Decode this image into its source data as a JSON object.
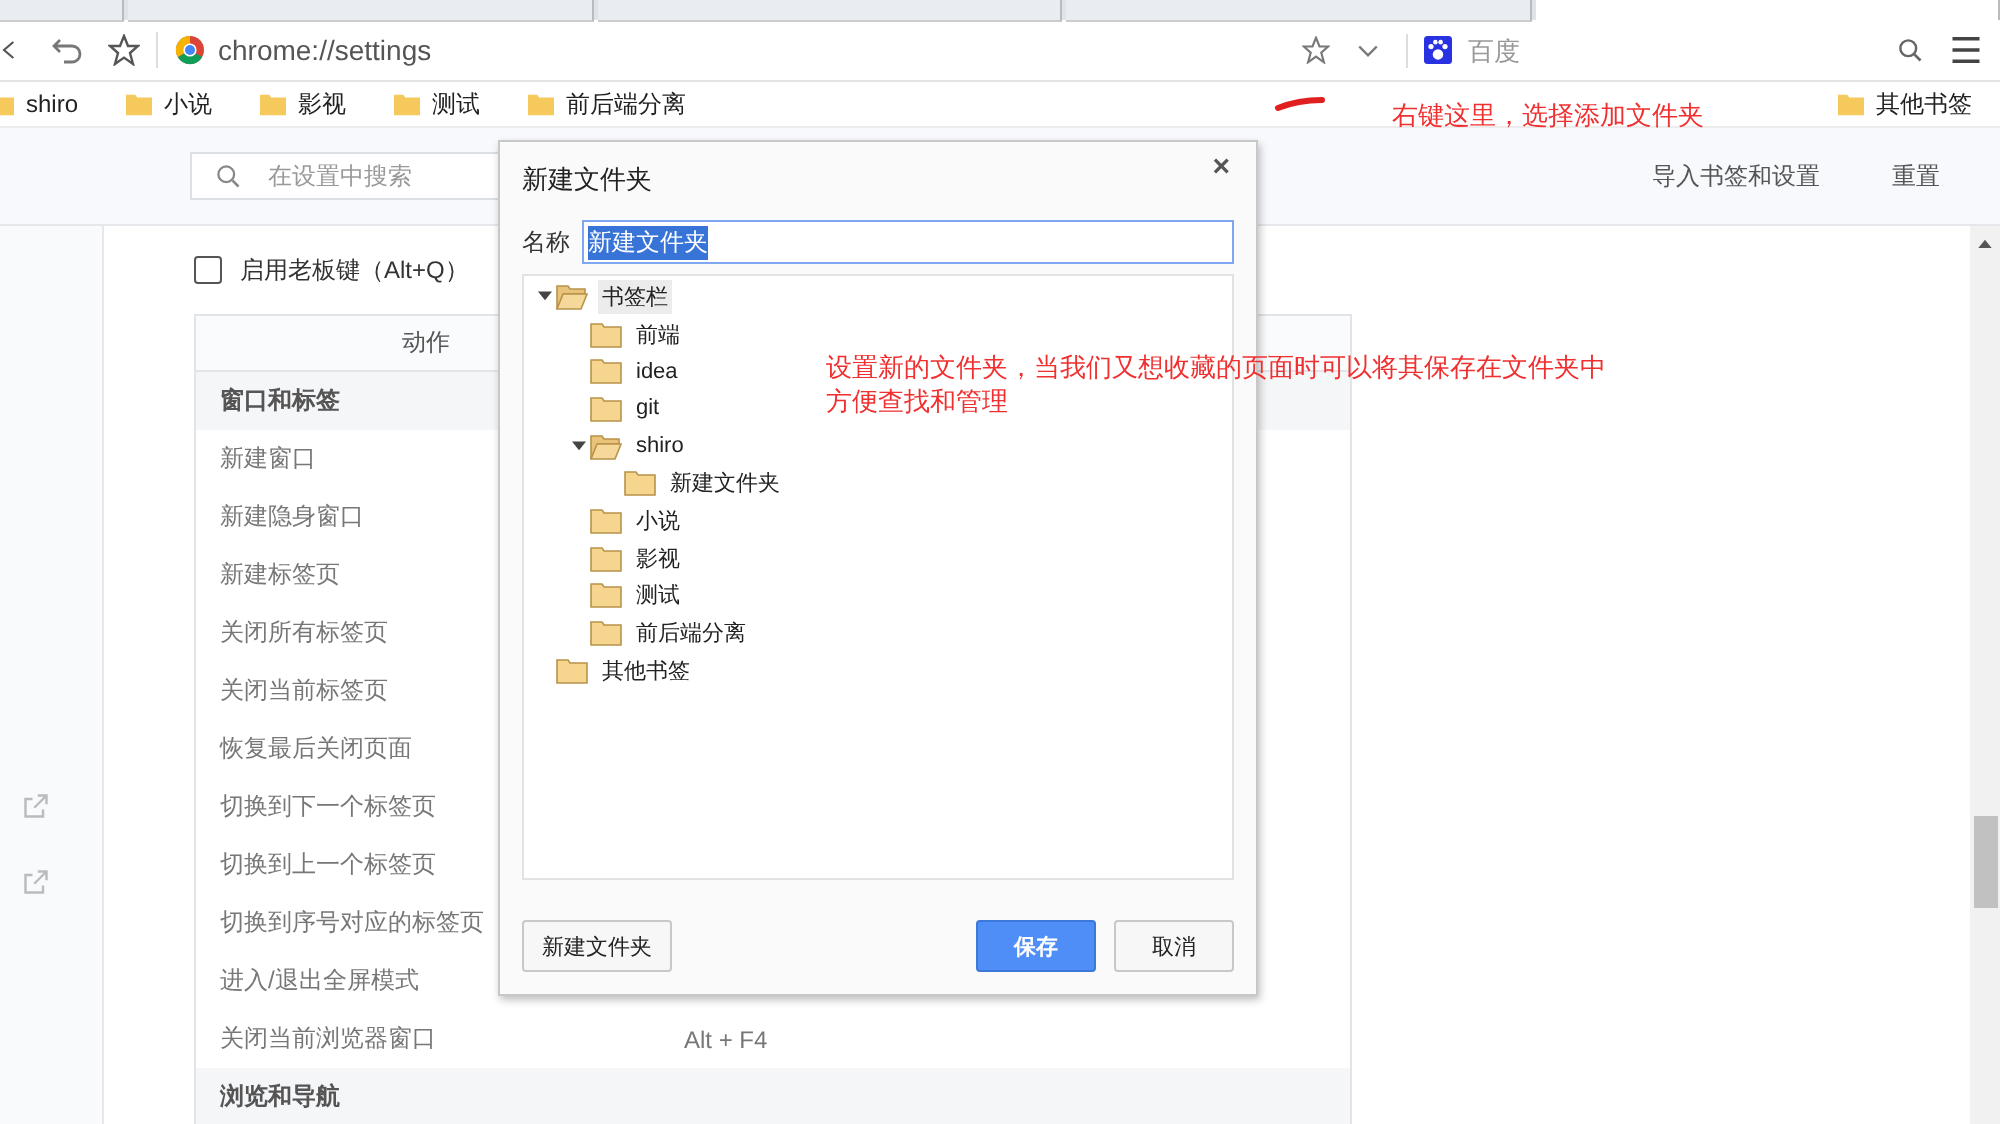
{
  "tabs": [
    {
      "selected": false
    },
    {
      "selected": false
    },
    {
      "selected": false
    },
    {
      "selected": false
    },
    {
      "selected": true
    }
  ],
  "toolbar": {
    "address": "chrome://settings",
    "search_placeholder": "百度"
  },
  "bookmarks_bar": {
    "items": [
      "shiro",
      "小说",
      "影视",
      "测试",
      "前后端分离"
    ],
    "other": "其他书签"
  },
  "settings_header": {
    "search_placeholder": "在设置中搜索",
    "links": [
      "导入书签和设置",
      "重置"
    ]
  },
  "boss_key": {
    "label": "启用老板键（Alt+Q）",
    "checked": false
  },
  "shortcuts_table": {
    "header": "动作",
    "rows": [
      {
        "kind": "section",
        "label": "窗口和标签"
      },
      {
        "kind": "action",
        "label": "新建窗口"
      },
      {
        "kind": "action",
        "label": "新建隐身窗口"
      },
      {
        "kind": "action",
        "label": "新建标签页"
      },
      {
        "kind": "action",
        "label": "关闭所有标签页"
      },
      {
        "kind": "action",
        "label": "关闭当前标签页"
      },
      {
        "kind": "action",
        "label": "恢复最后关闭页面"
      },
      {
        "kind": "action",
        "label": "切换到下一个标签页"
      },
      {
        "kind": "action",
        "label": "切换到上一个标签页"
      },
      {
        "kind": "action",
        "label": "切换到序号对应的标签页"
      },
      {
        "kind": "action",
        "label": "进入/退出全屏模式"
      },
      {
        "kind": "action",
        "label": "关闭当前浏览器窗口",
        "shortcut": "Alt + F4"
      },
      {
        "kind": "section",
        "label": "浏览和导航"
      }
    ]
  },
  "dialog": {
    "title": "新建文件夹",
    "close": "×",
    "name_label": "名称",
    "name_value": "新建文件夹",
    "tree": [
      {
        "label": "书签栏",
        "selected": true,
        "expanded": true,
        "children": [
          {
            "label": "前端",
            "selected": false
          },
          {
            "label": "idea",
            "selected": false
          },
          {
            "label": "git",
            "selected": false
          },
          {
            "label": "shiro",
            "selected": false,
            "expanded": true,
            "children": [
              {
                "label": "新建文件夹",
                "selected": false
              }
            ]
          },
          {
            "label": "小说",
            "selected": false
          },
          {
            "label": "影视",
            "selected": false
          },
          {
            "label": "测试",
            "selected": false
          },
          {
            "label": "前后端分离",
            "selected": false
          }
        ]
      },
      {
        "label": "其他书签",
        "selected": false
      }
    ],
    "buttons": [
      {
        "label": "新建文件夹",
        "kind": "secondary"
      },
      {
        "label": "保存",
        "kind": "primary"
      },
      {
        "label": "取消",
        "kind": "secondary"
      }
    ]
  },
  "annotations": [
    "右键这里，选择添加文件夹",
    "设置新的文件夹，当我们又想收藏的页面时可以将其保存在文件夹中",
    "方便查找和管理"
  ]
}
